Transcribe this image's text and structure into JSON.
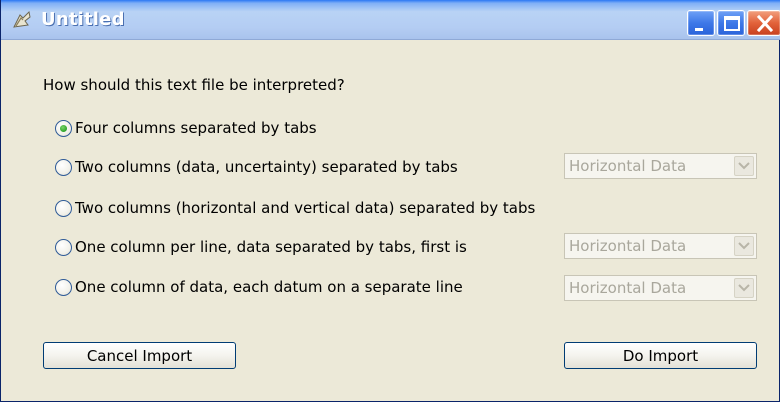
{
  "window": {
    "title": "Untitled",
    "app_icon": "app-icon"
  },
  "dialog": {
    "prompt": "How should this text file be interpreted?",
    "options": [
      {
        "label": "Four columns separated by tabs",
        "checked": true
      },
      {
        "label": "Two columns (data, uncertainty) separated by tabs",
        "checked": false,
        "select_value": "Horizontal Data"
      },
      {
        "label": "Two columns (horizontal and vertical data) separated by tabs",
        "checked": false
      },
      {
        "label": "One column per line, data separated by tabs, first is",
        "checked": false,
        "select_value": "Horizontal Data"
      },
      {
        "label": "One column of data, each datum on a separate line",
        "checked": false,
        "select_value": "Horizontal Data"
      }
    ],
    "cancel_label": "Cancel Import",
    "do_label": "Do Import"
  },
  "colors": {
    "dialog_bg": "#ECE9D8",
    "titlebar": "#B4CDF3",
    "radio_selected": "#2EA32A"
  }
}
